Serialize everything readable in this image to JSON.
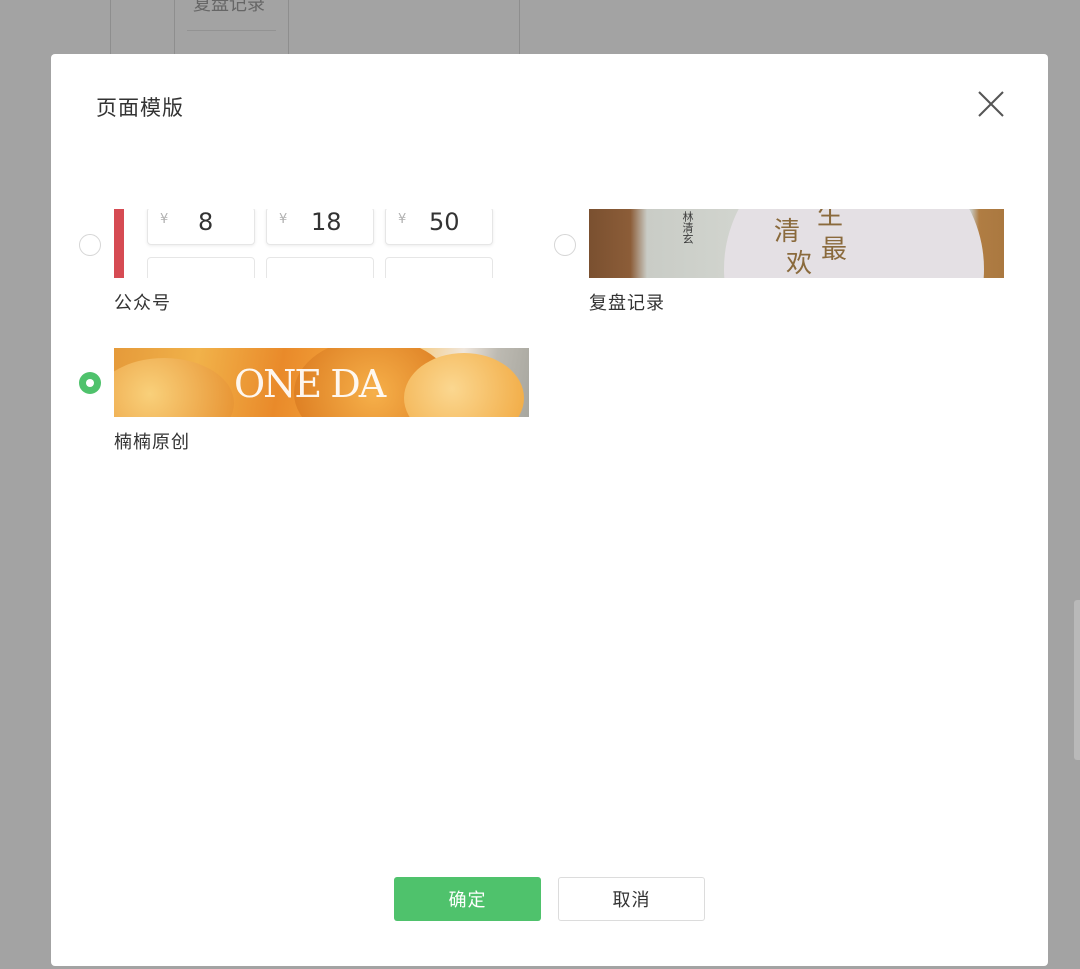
{
  "background": {
    "menu_item": "复盘记录"
  },
  "dialog": {
    "title": "页面模版",
    "close_icon": "close-icon",
    "options": [
      {
        "label": "公众号",
        "selected": false,
        "thumbnail": {
          "currency": "¥",
          "prices": [
            "8",
            "18",
            "50"
          ]
        }
      },
      {
        "label": "复盘记录",
        "selected": false,
        "thumbnail": {
          "chars": [
            "清",
            "生",
            "最",
            "欢"
          ],
          "author": "林清玄"
        }
      },
      {
        "label": "楠楠原创",
        "selected": true,
        "thumbnail": {
          "text": "ONE DA"
        }
      }
    ],
    "confirm_label": "确定",
    "cancel_label": "取消"
  },
  "colors": {
    "overlay": "#a3a3a3",
    "accent": "#4fc26c",
    "red_bar": "#d64b53"
  }
}
